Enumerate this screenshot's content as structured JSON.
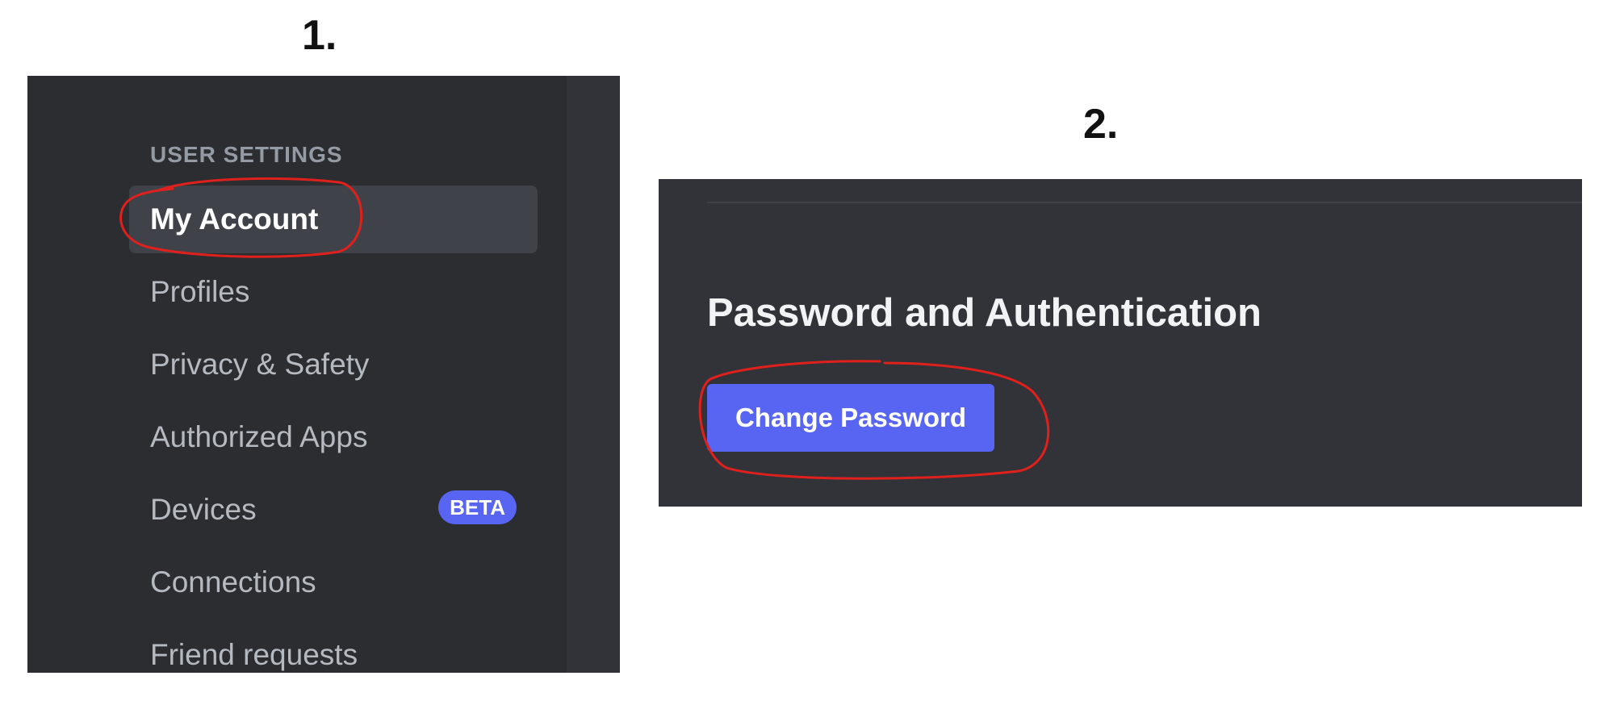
{
  "steps": {
    "step1_label": "1.",
    "step2_label": "2."
  },
  "sidebar": {
    "section_header": "USER SETTINGS",
    "items": [
      {
        "label": "My Account",
        "selected": true
      },
      {
        "label": "Profiles"
      },
      {
        "label": "Privacy & Safety"
      },
      {
        "label": "Authorized Apps"
      },
      {
        "label": "Devices",
        "badge": "BETA"
      },
      {
        "label": "Connections"
      },
      {
        "label": "Friend requests"
      }
    ]
  },
  "password_section": {
    "title": "Password and Authentication",
    "button_label": "Change Password"
  },
  "colors": {
    "sidebar_bg": "#2b2d31",
    "content_bg": "#313338",
    "selected_item_bg": "#404249",
    "accent": "#5865f2",
    "annotation": "#e0201c"
  },
  "annotations": [
    {
      "type": "circle",
      "target": "sidebar-item-my-account"
    },
    {
      "type": "circle",
      "target": "change-password-button"
    }
  ]
}
